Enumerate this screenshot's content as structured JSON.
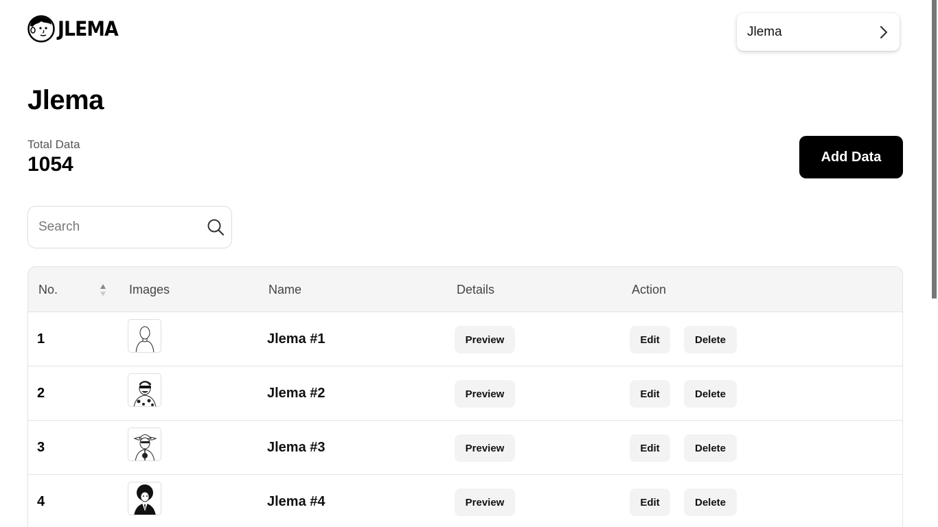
{
  "brand": {
    "logo_text": "JLEMA",
    "logo_icon": "face-logo-icon"
  },
  "user_menu": {
    "name": "Jlema",
    "icon": "chevron-right-icon"
  },
  "page": {
    "title": "Jlema"
  },
  "stats": {
    "total_label": "Total Data",
    "total_value": "1054"
  },
  "actions": {
    "add_label": "Add Data"
  },
  "search": {
    "placeholder": "Search",
    "value": "",
    "icon": "search-icon"
  },
  "table": {
    "headers": {
      "no": "No.",
      "images": "Images",
      "name": "Name",
      "details": "Details",
      "action": "Action"
    },
    "sort_icon": "sort-arrows-icon",
    "rows": [
      {
        "no": "1",
        "name": "Jlema #1",
        "preview": "Preview",
        "edit": "Edit",
        "delete": "Delete",
        "image": "avatar-plain"
      },
      {
        "no": "2",
        "name": "Jlema #2",
        "preview": "Preview",
        "edit": "Edit",
        "delete": "Delete",
        "image": "avatar-sunglasses-hawaiian"
      },
      {
        "no": "3",
        "name": "Jlema #3",
        "preview": "Preview",
        "edit": "Edit",
        "delete": "Delete",
        "image": "avatar-cowboy"
      },
      {
        "no": "4",
        "name": "Jlema #4",
        "preview": "Preview",
        "edit": "Edit",
        "delete": "Delete",
        "image": "avatar-afro-suit"
      }
    ]
  },
  "colors": {
    "primary": "#000000",
    "button_bg": "#f3f3f3",
    "header_bg": "#f5f5f5",
    "border": "#e3e3e3"
  }
}
